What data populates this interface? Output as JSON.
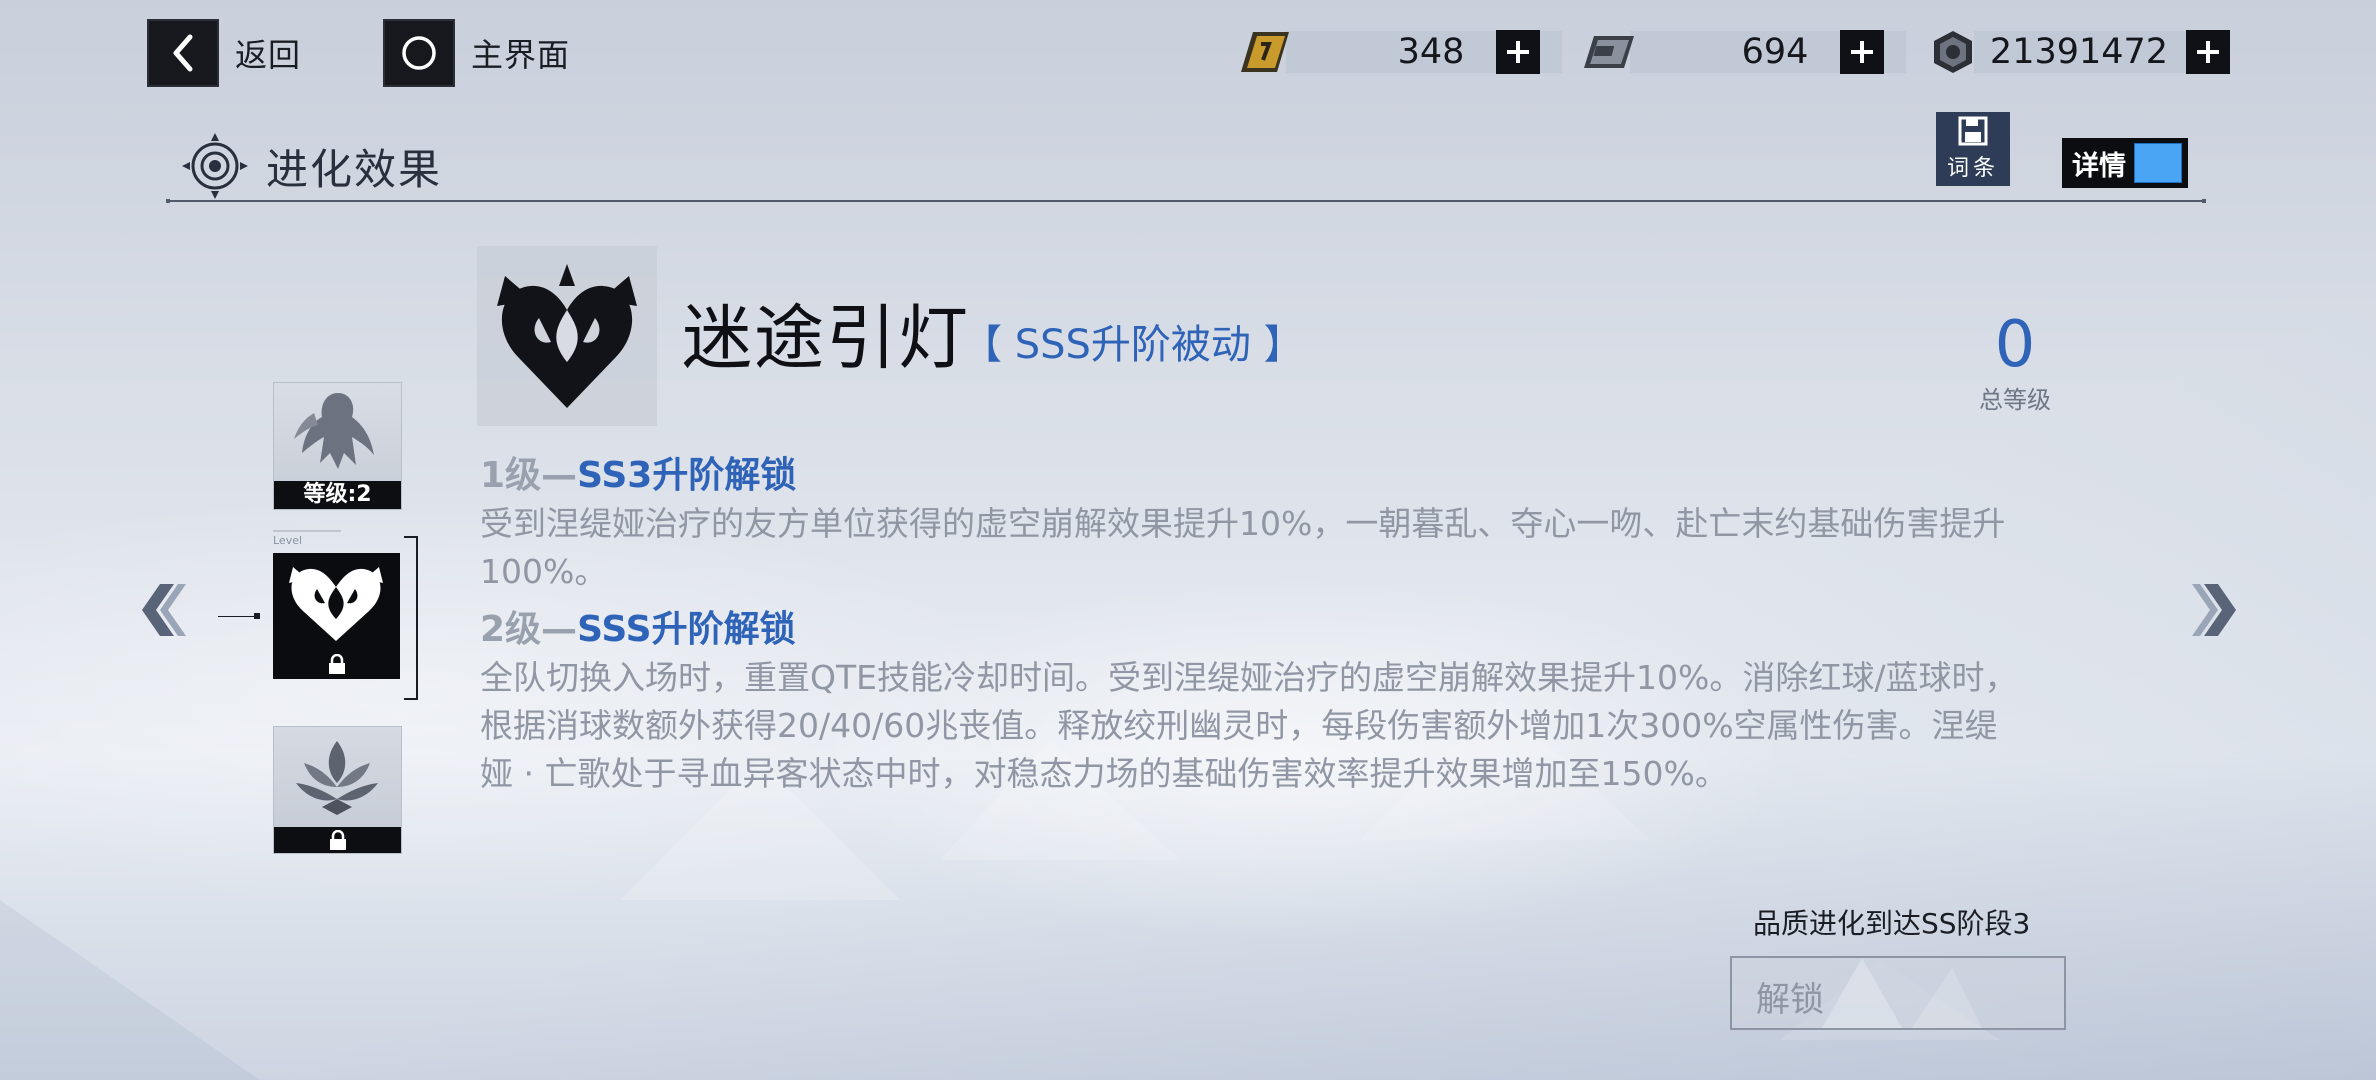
{
  "topbar": {
    "back_label": "返回",
    "home_label": "主界面",
    "resources": [
      {
        "icon": "gold-ticket-icon",
        "value": "348"
      },
      {
        "icon": "chip-icon",
        "value": "694"
      },
      {
        "icon": "hex-nut-icon",
        "value": "21391472"
      }
    ]
  },
  "header": {
    "title": "进化效果",
    "entry_button_label": "词条",
    "detail_toggle_label": "详情",
    "detail_toggle_on": true
  },
  "left_list": {
    "level_tag": "Level",
    "slots": [
      {
        "icon": "character-silhouette-icon",
        "level_label": "等级:2",
        "locked": false
      },
      {
        "icon": "heart-emblem-icon",
        "locked": true,
        "selected": true
      },
      {
        "icon": "lotus-icon",
        "locked": true
      }
    ]
  },
  "skill": {
    "name": "迷途引灯",
    "type_label": "【 SSS升阶被动 】",
    "total_level_value": "0",
    "total_level_label": "总等级",
    "levels": [
      {
        "prefix": "1级—",
        "title": "SS3升阶解锁",
        "desc": "受到涅缇娅治疗的友方单位获得的虚空崩解效果提升10%，一朝暮乱、夺心一吻、赴亡末约基础伤害提升100%。"
      },
      {
        "prefix": "2级—",
        "title": "SSS升阶解锁",
        "desc": "全队切换入场时，重置QTE技能冷却时间。受到涅缇娅治疗的虚空崩解效果提升10%。消除红球/蓝球时，根据消球数额外获得20/40/60兆丧值。释放绞刑幽灵时，每段伤害额外增加1次300%空属性伤害。涅缇娅 · 亡歌处于寻血异客状态中时，对稳态力场的基础伤害效率提升效果增加至150%。"
      }
    ]
  },
  "unlock": {
    "requirement": "品质进化到达SS阶段3",
    "button_label": "解锁"
  },
  "colors": {
    "accent_blue": "#2f63b7",
    "toggle_blue": "#4aa5f5",
    "dark": "#0d0e12"
  }
}
